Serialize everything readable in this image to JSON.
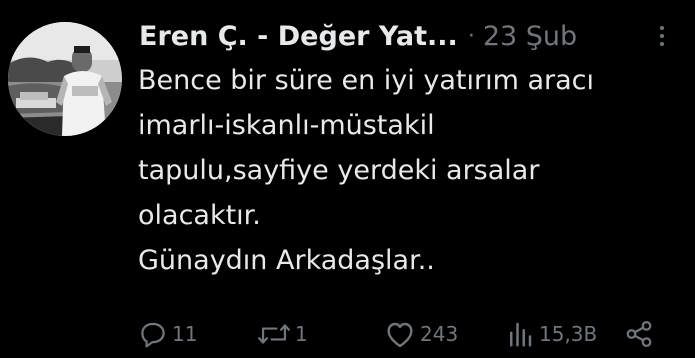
{
  "author": {
    "display_name": "Eren Ç. - Değer Yat...",
    "separator": "·",
    "date": "23 Şub"
  },
  "tweet": {
    "lines": [
      "Bence bir süre en iyi yatırım aracı",
      "imarlı-iskanlı-müstakil",
      "tapulu,sayfiye yerdeki arsalar",
      "olacaktır.",
      "Günaydın Arkadaşlar.."
    ]
  },
  "actions": {
    "replies": "11",
    "reposts": "1",
    "likes": "243",
    "views": "15,3B"
  },
  "colors": {
    "background": "#000000",
    "text": "#e7e9ea",
    "muted": "#71767b"
  },
  "icons": {
    "more": "more-options-icon",
    "reply": "reply-icon",
    "repost": "repost-icon",
    "like": "heart-icon",
    "views": "views-icon",
    "share": "share-icon"
  }
}
